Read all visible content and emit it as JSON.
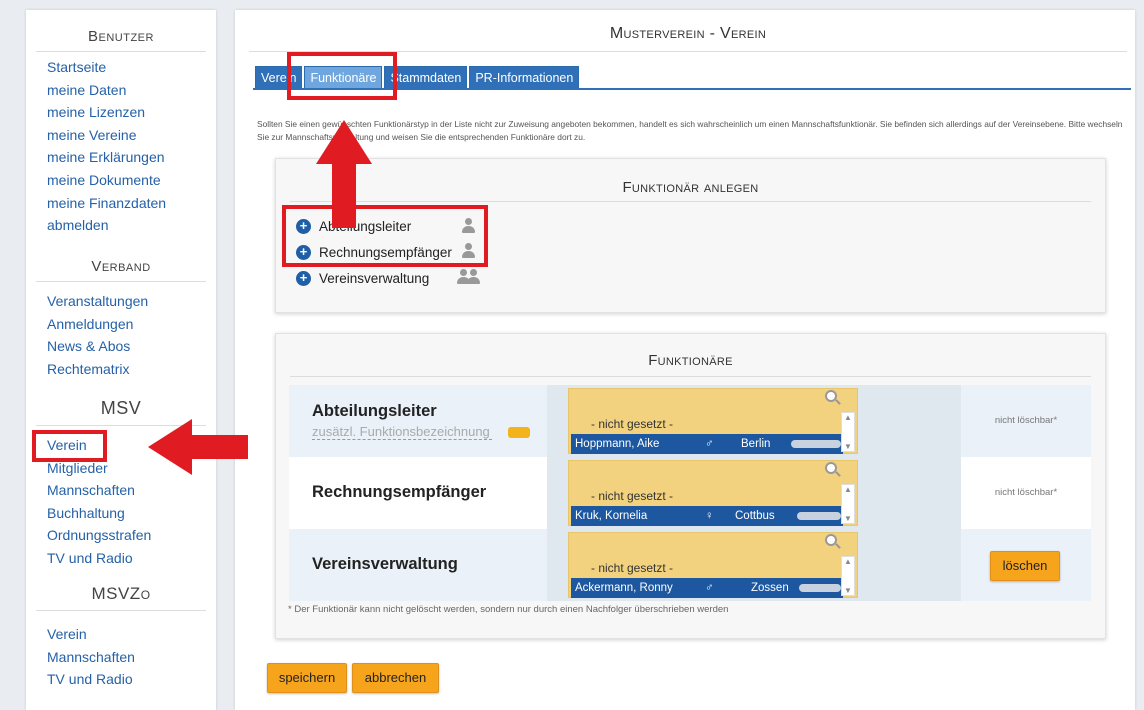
{
  "sidebar": {
    "sections": [
      {
        "title": "Benutzer",
        "items": [
          "Startseite",
          "meine Daten",
          "meine Lizenzen",
          "meine Vereine",
          "meine Erklärungen",
          "meine Dokumente",
          "meine Finanzdaten",
          "abmelden"
        ]
      },
      {
        "title": "Verband",
        "items": [
          "Veranstaltungen",
          "Anmeldungen",
          "News & Abos",
          "Rechtematrix"
        ]
      },
      {
        "title": "MSV",
        "items": [
          "Verein",
          "Mitglieder",
          "Mannschaften",
          "Buchhaltung",
          "Ordnungsstrafen",
          "TV und Radio"
        ]
      },
      {
        "title": "MSVZo",
        "items": [
          "Verein",
          "Mannschaften",
          "TV und Radio"
        ]
      }
    ]
  },
  "main": {
    "title": "Musterverein - Verein",
    "tabs": [
      "Verein",
      "Funktionäre",
      "Stammdaten",
      "PR-Informationen"
    ],
    "selected_tab": "Funktionäre",
    "info_text": "Sollten Sie einen gewünschten Funktionärstyp in der Liste nicht zur Zuweisung angeboten bekommen, handelt es sich wahrscheinlich um einen Mannschaftsfunktionär. Sie befinden sich allerdings auf der Vereinsebene. Bitte wechseln Sie zur Mannschaftsverwaltung und weisen Sie die entsprechenden Funktionäre dort zu.",
    "create_panel": {
      "title": "Funktionär anlegen",
      "items": [
        {
          "label": "Abteilungsleiter",
          "icon": "person-icon"
        },
        {
          "label": "Rechnungsempfänger",
          "icon": "person-icon"
        },
        {
          "label": "Vereinsverwaltung",
          "icon": "group-icon"
        }
      ]
    },
    "functionaries_panel": {
      "title": "Funktionäre",
      "rows": [
        {
          "role": "Abteilungsleiter",
          "extra_placeholder": "zusätzl. Funktionsbezeichnung",
          "not_set": "- nicht gesetzt -",
          "name": "Hoppmann, Aike",
          "gender": "♂",
          "city": "Berlin",
          "action": "nicht löschbar*"
        },
        {
          "role": "Rechnungsempfänger",
          "not_set": "- nicht gesetzt -",
          "name": "Kruk, Kornelia",
          "gender": "♀",
          "city": "Cottbus",
          "action": "nicht löschbar*"
        },
        {
          "role": "Vereinsverwaltung",
          "not_set": "- nicht gesetzt -",
          "name": "Ackermann, Ronny",
          "gender": "♂",
          "city": "Zossen",
          "action": "löschen"
        }
      ],
      "footnote": "* Der Funktionär kann nicht gelöscht werden, sondern nur durch einen Nachfolger überschrieben werden"
    },
    "buttons": {
      "save": "speichern",
      "cancel": "abbrechen"
    }
  },
  "colors": {
    "accent": "#2f70b8",
    "button": "#f6a41c",
    "annotation": "#e11b22",
    "selection": "#1d57a0"
  }
}
